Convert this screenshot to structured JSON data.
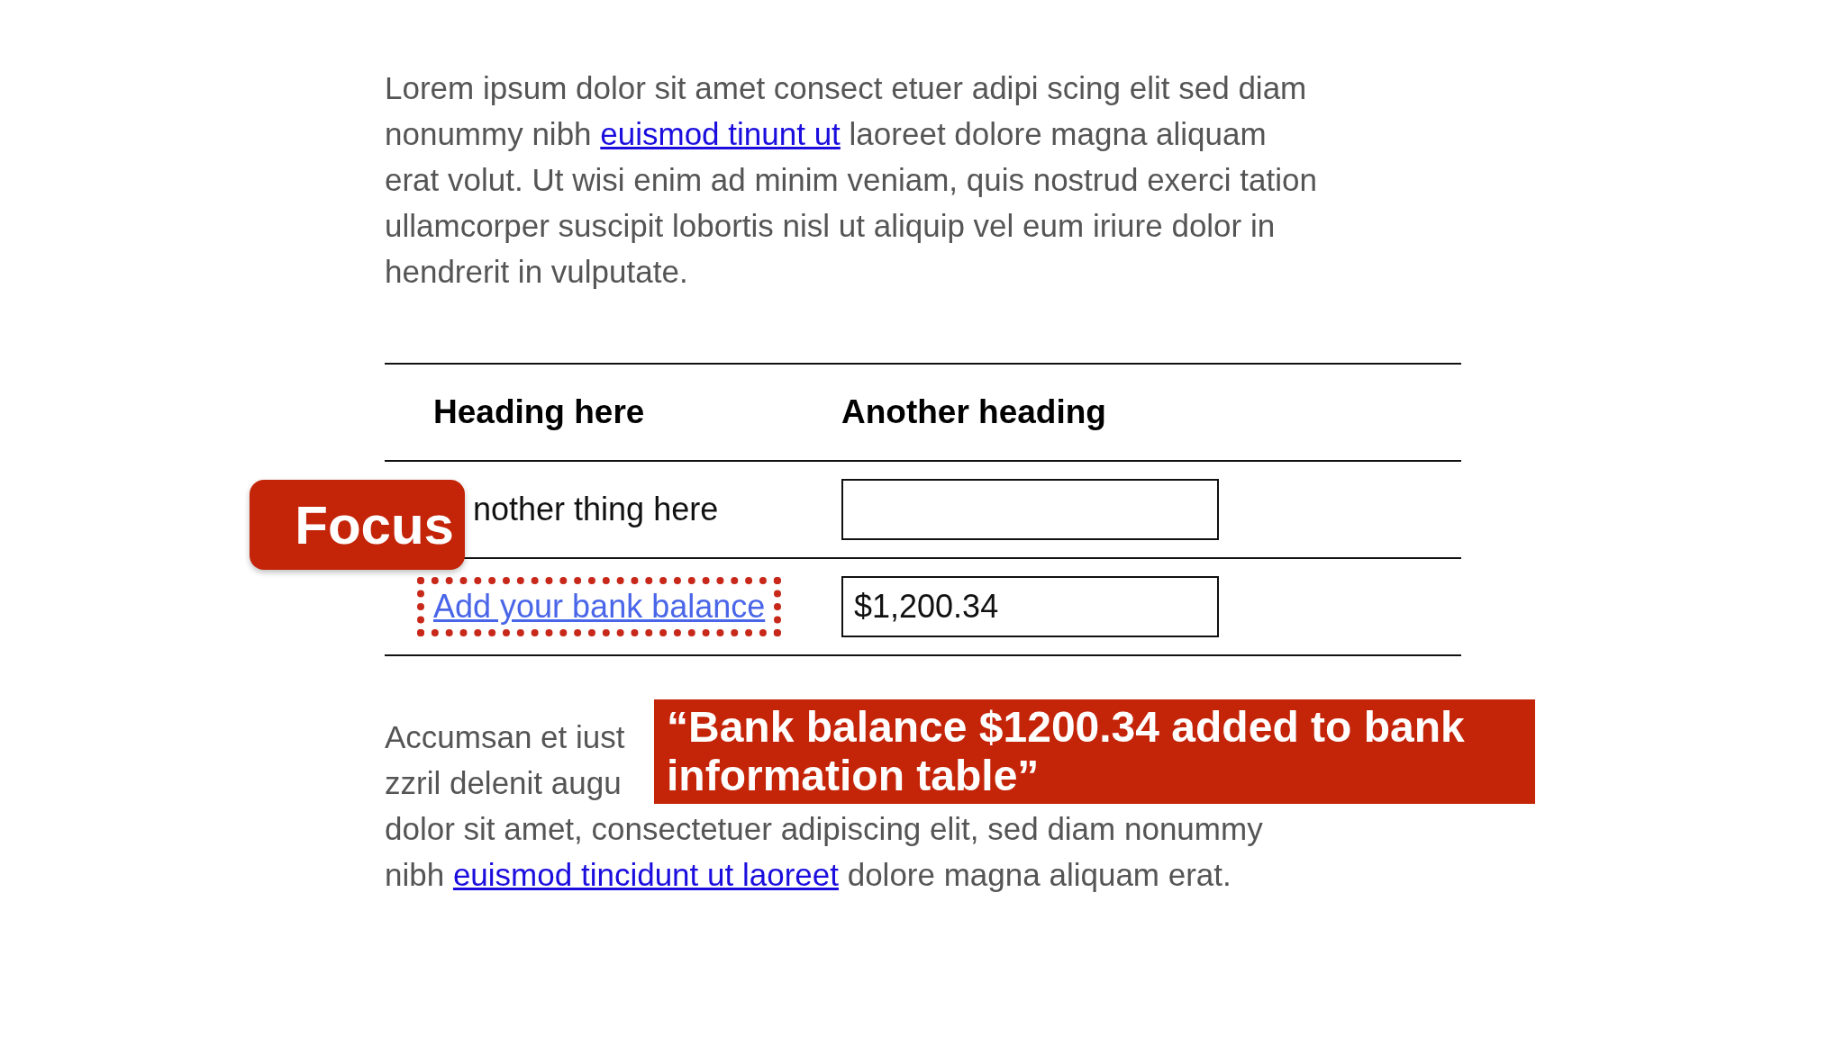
{
  "intro": {
    "before": "Lorem ipsum dolor sit amet consect etuer adipi scing elit sed diam nonummy nibh ",
    "link": "euismod tinunt ut",
    "after": " laoreet dolore magna aliquam erat volut. Ut wisi enim ad minim veniam, quis nostrud exerci tation ullamcorper suscipit lobortis nisl ut aliquip vel eum iriure dolor in hendrerit in vulputate."
  },
  "table": {
    "columns": [
      "Heading here",
      "Another heading"
    ],
    "rows": [
      {
        "kind": "text",
        "label": "nother thing here",
        "value": "",
        "focused": false
      },
      {
        "kind": "link",
        "label": "Add your bank balance",
        "value": "$1,200.34",
        "focused": true
      }
    ]
  },
  "outro": {
    "lines": [
      "Accumsan et iust",
      "zzril delenit augu",
      "dolor sit amet, consectetuer adipiscing elit, sed diam nonummy"
    ],
    "before": "nibh ",
    "link": "euismod tincidunt ut laoreet",
    "after": " dolore magna aliquam erat."
  },
  "focus_badge": "Focus",
  "announcement": "“Bank balance $1200.34 added to bank information table”"
}
